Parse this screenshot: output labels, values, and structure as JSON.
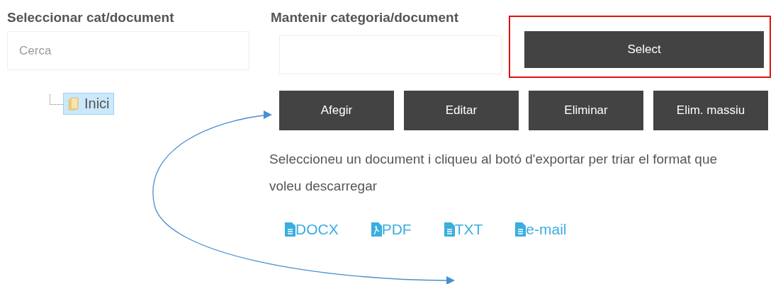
{
  "left_panel": {
    "title": "Seleccionar cat/document",
    "search": {
      "placeholder": "Cerca"
    },
    "tree": [
      {
        "label": "Inici",
        "selected": true
      }
    ]
  },
  "right_panel": {
    "title": "Mantenir categoria/document",
    "select_button": {
      "label": "Select",
      "highlighted": true
    },
    "buttons": [
      "Afegir",
      "Editar",
      "Eliminar",
      "Elim. massiu"
    ],
    "instructions": "Seleccioneu un document i cliqueu al botó d'exportar per triar el format que voleu descarregar",
    "export_links": [
      {
        "kind": "doc",
        "label": "DOCX"
      },
      {
        "kind": "pdf",
        "label": "PDF"
      },
      {
        "kind": "doc",
        "label": "TXT"
      },
      {
        "kind": "doc",
        "label": "e-mail"
      }
    ]
  }
}
